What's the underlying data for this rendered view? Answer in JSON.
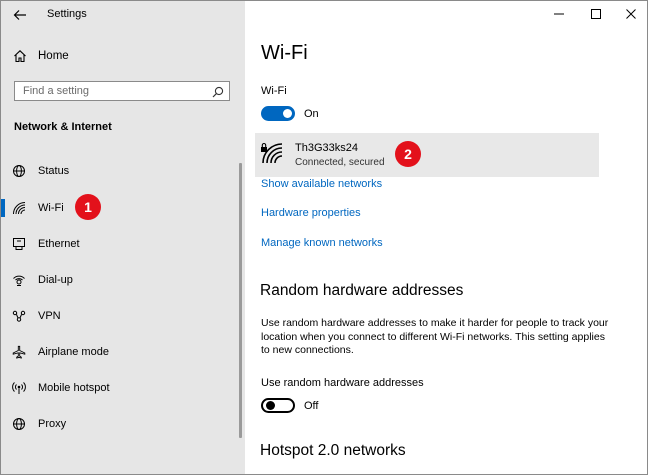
{
  "window": {
    "title": "Settings",
    "back_icon": "back-arrow-icon",
    "controls": [
      "minimize-icon",
      "maximize-icon",
      "close-icon"
    ]
  },
  "sidebar": {
    "home_label": "Home",
    "search_placeholder": "Find a setting",
    "section_title": "Network & Internet",
    "items": [
      {
        "label": "Status",
        "icon": "globe-icon",
        "selected": false
      },
      {
        "label": "Wi-Fi",
        "icon": "wifi-icon",
        "selected": true
      },
      {
        "label": "Ethernet",
        "icon": "ethernet-icon",
        "selected": false
      },
      {
        "label": "Dial-up",
        "icon": "dial-up-icon",
        "selected": false
      },
      {
        "label": "VPN",
        "icon": "vpn-icon",
        "selected": false
      },
      {
        "label": "Airplane mode",
        "icon": "airplane-icon",
        "selected": false
      },
      {
        "label": "Mobile hotspot",
        "icon": "hotspot-icon",
        "selected": false
      },
      {
        "label": "Proxy",
        "icon": "globe-icon",
        "selected": false
      }
    ]
  },
  "annotations": {
    "badge1": "1",
    "badge2": "2",
    "badge_color": "#e3111b"
  },
  "main": {
    "page_title": "Wi-Fi",
    "wifi_toggle_label": "Wi-Fi",
    "wifi_toggle_state": "On",
    "network": {
      "name": "Th3G33ks24",
      "status": "Connected, secured",
      "icon": "secured-wifi-icon"
    },
    "links": {
      "show_networks": "Show available networks",
      "hardware_properties": "Hardware properties",
      "manage_networks": "Manage known networks"
    },
    "random_hw": {
      "title": "Random hardware addresses",
      "description": "Use random hardware addresses to make it harder for people to track your location when you connect to different Wi-Fi networks. This setting applies to new connections.",
      "option_label": "Use random hardware addresses",
      "toggle_state": "Off"
    },
    "hotspot_title": "Hotspot 2.0 networks"
  },
  "colors": {
    "accent": "#0067c0",
    "sidebar_bg": "#e6e6e6",
    "card_bg": "#e8e8e8"
  }
}
